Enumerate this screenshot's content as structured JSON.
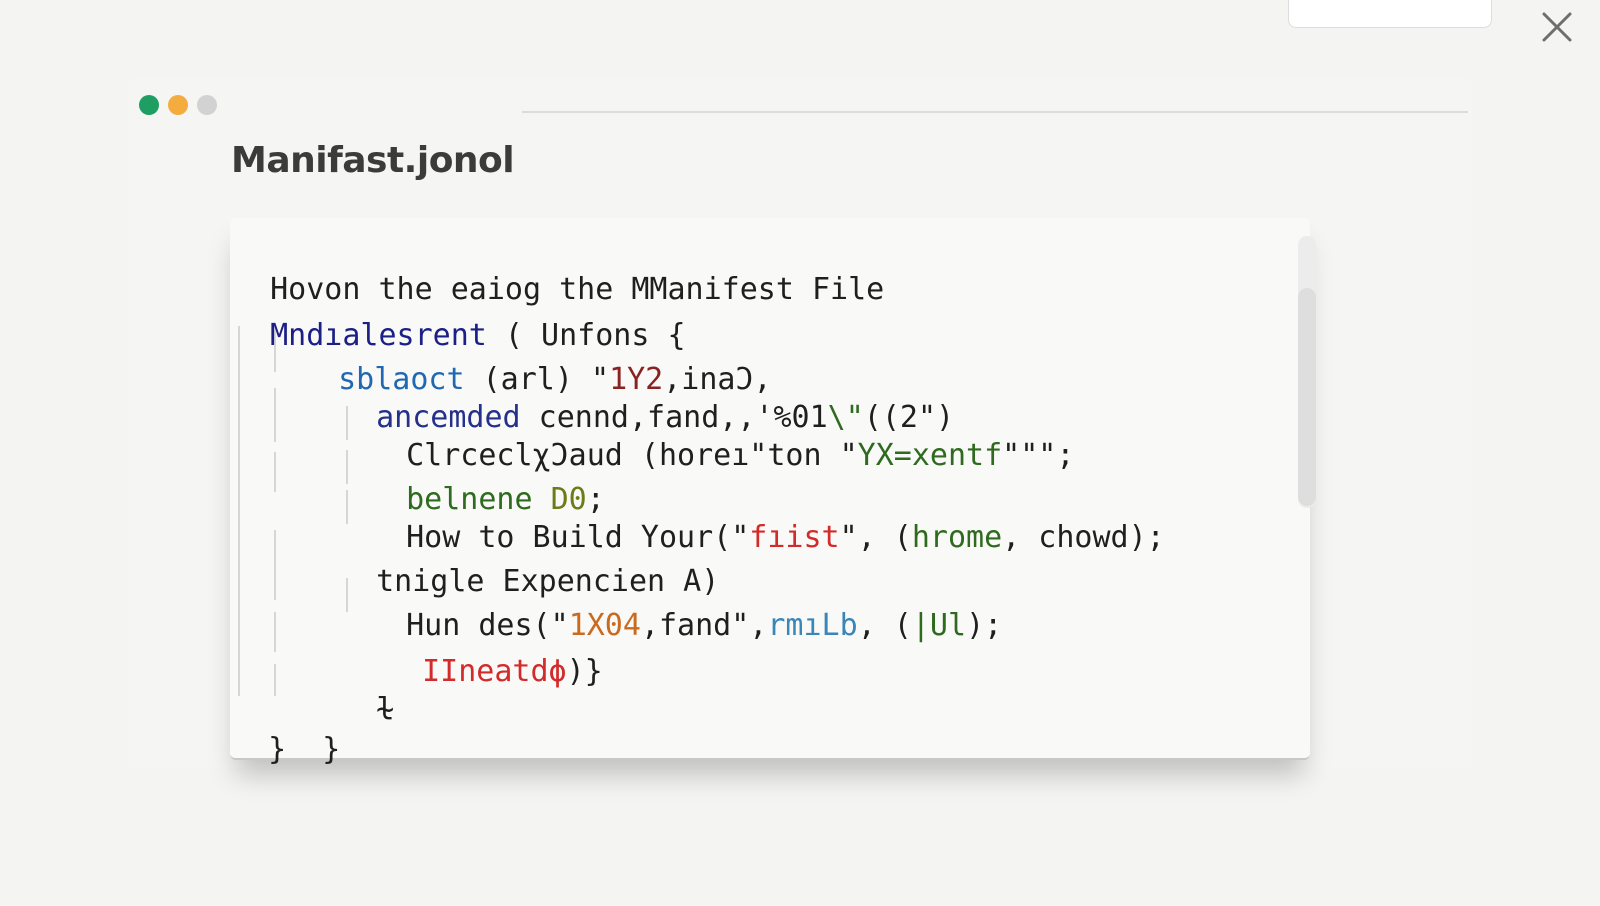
{
  "window": {
    "title": "Manifast.jonol"
  },
  "colors": {
    "dot_green": "#1e9e63",
    "dot_yellow": "#f4ac3f",
    "dot_gray": "#d2d2d2"
  },
  "icons": {
    "close": "close-icon"
  },
  "code": {
    "line1": "Hovon the eaiog the MManifest File",
    "line2": {
      "a": "Mndıalesrent",
      "b": " ( Unfons {"
    },
    "line3": {
      "a": "sblaoct",
      "b": " (arl) \"",
      "c": "1Y2",
      "d": ",inaϽ,"
    },
    "line4": {
      "a": "ancemded",
      "b": " cennd,fand,,'%01",
      "c": "\\\"",
      "d": "((2\")"
    },
    "line5": {
      "a": "ClrceclχƆaud (horeı\"ton \"",
      "b": "YX=xentf",
      "c": "\"\"\";"
    },
    "line6": {
      "a": "belnene",
      "b": " D0",
      "c": ";"
    },
    "line7": {
      "a": "How to Build Your(\"",
      "b": "fıist",
      "c": "\", (",
      "d": "hrome",
      "e": ", chowd);"
    },
    "line8": "tnigle Expencien A)",
    "line9": {
      "a": "Hun des(\"",
      "b": "1X04",
      "c": ",fand\",",
      "d": "rmıLb",
      "e": ", (",
      "f": "|Ul",
      "g": ");"
    },
    "line10": {
      "a": "IIneatdϕ",
      "b": ")}"
    },
    "line11": "ɫ",
    "line12": "}  }"
  }
}
